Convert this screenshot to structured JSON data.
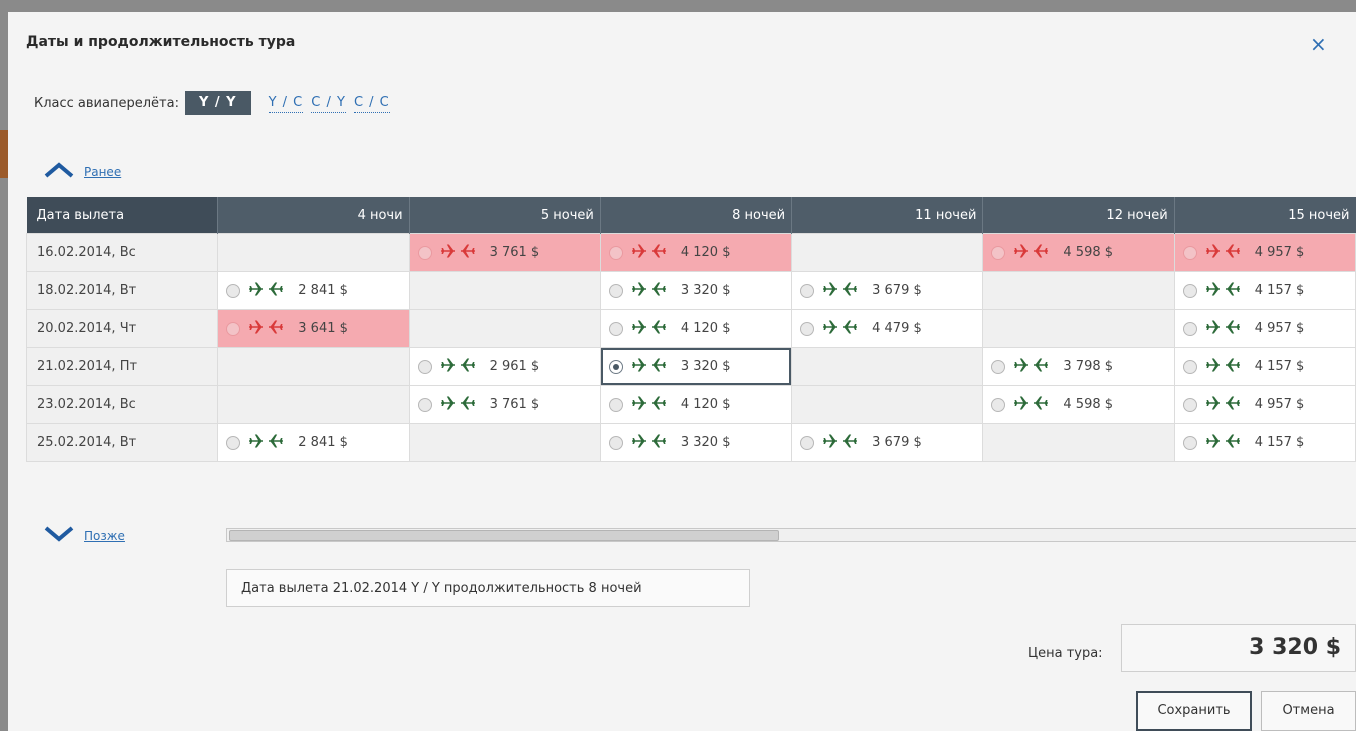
{
  "dialog": {
    "title": "Даты и продолжительность тура",
    "close_label": "×"
  },
  "flight_class": {
    "label": "Класс авиаперелёта:",
    "options": [
      "Y / Y",
      "Y / C",
      "C / Y",
      "C / C"
    ],
    "selected": "Y / Y"
  },
  "nav": {
    "earlier": "Ранее",
    "later": "Позже"
  },
  "grid": {
    "headers": [
      "Дата вылета",
      "4 ночи",
      "5 ночей",
      "8 ночей",
      "11 ночей",
      "12 ночей",
      "15 ночей"
    ],
    "rows": [
      {
        "date": "16.02.2014, Вс",
        "cells": [
          null,
          {
            "price": "3 761 $",
            "state": "hot"
          },
          {
            "price": "4 120 $",
            "state": "hot"
          },
          null,
          {
            "price": "4 598 $",
            "state": "hot"
          },
          {
            "price": "4 957 $",
            "state": "hot"
          }
        ]
      },
      {
        "date": "18.02.2014, Вт",
        "cells": [
          {
            "price": "2 841 $",
            "state": "avail"
          },
          null,
          {
            "price": "3 320 $",
            "state": "avail"
          },
          {
            "price": "3 679 $",
            "state": "avail"
          },
          null,
          {
            "price": "4 157 $",
            "state": "avail"
          }
        ]
      },
      {
        "date": "20.02.2014, Чт",
        "cells": [
          {
            "price": "3 641 $",
            "state": "hot"
          },
          null,
          {
            "price": "4 120 $",
            "state": "avail"
          },
          {
            "price": "4 479 $",
            "state": "avail"
          },
          null,
          {
            "price": "4 957 $",
            "state": "avail"
          }
        ]
      },
      {
        "date": "21.02.2014, Пт",
        "cells": [
          null,
          {
            "price": "2 961 $",
            "state": "avail"
          },
          {
            "price": "3 320 $",
            "state": "selected"
          },
          null,
          {
            "price": "3 798 $",
            "state": "avail"
          },
          {
            "price": "4 157 $",
            "state": "avail"
          }
        ]
      },
      {
        "date": "23.02.2014, Вс",
        "cells": [
          null,
          {
            "price": "3 761 $",
            "state": "avail"
          },
          {
            "price": "4 120 $",
            "state": "avail"
          },
          null,
          {
            "price": "4 598 $",
            "state": "avail"
          },
          {
            "price": "4 957 $",
            "state": "avail"
          }
        ]
      },
      {
        "date": "25.02.2014, Вт",
        "cells": [
          {
            "price": "2 841 $",
            "state": "avail"
          },
          null,
          {
            "price": "3 320 $",
            "state": "avail"
          },
          {
            "price": "3 679 $",
            "state": "avail"
          },
          null,
          {
            "price": "4 157 $",
            "state": "avail"
          }
        ]
      }
    ]
  },
  "summary": "Дата вылета 21.02.2014 Y / Y продолжительность 8 ночей",
  "tour_price": {
    "label": "Цена тура:",
    "value": "3 320 $"
  },
  "buttons": {
    "save": "Сохранить",
    "cancel": "Отмена"
  },
  "colors": {
    "header_bg": "#4f5d69",
    "hot_bg": "#f5aab0",
    "plane_green": "#2d6b3a",
    "plane_red": "#d93a3a",
    "link": "#2f6fb3"
  },
  "icons": {
    "depart": "plane-right-icon",
    "return": "plane-left-icon",
    "earlier": "chevron-up-icon",
    "later": "chevron-down-icon",
    "close": "close-icon"
  }
}
